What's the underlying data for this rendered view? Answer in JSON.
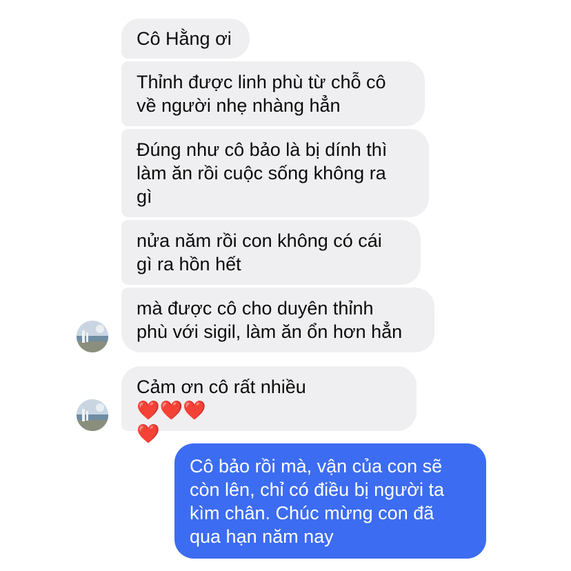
{
  "colors": {
    "incoming_bubble": "#efeff1",
    "outgoing_bubble": "#3c6cf1",
    "incoming_text": "#0b0b0b",
    "outgoing_text": "#ffffff"
  },
  "messages": [
    {
      "side": "incoming",
      "text": "Cô Hằng ơi"
    },
    {
      "side": "incoming",
      "text": "Thỉnh được linh phù từ chỗ cô\nvề người nhẹ nhàng hẳn"
    },
    {
      "side": "incoming",
      "text": "Đúng như cô bảo là bị dính thì\nlàm ăn rồi cuộc sống không ra\ngì"
    },
    {
      "side": "incoming",
      "text": "nửa năm rồi con không có cái\ngì ra hồn hết"
    },
    {
      "side": "incoming",
      "text": "mà được cô cho duyên thỉnh\nphù với sigil, làm ăn ổn hơn hẳn"
    },
    {
      "side": "incoming",
      "text": "Cảm ơn cô rất nhiều",
      "emoji": "❤️❤️❤️\n❤️"
    },
    {
      "side": "outgoing",
      "text": "Cô bảo rồi mà, vận của con sẽ\ncòn lên, chỉ có điều bị người ta\nkìm chân. Chúc mừng con đã\nqua hạn năm nay"
    }
  ],
  "avatar": {
    "icon": "contact-avatar-photo"
  }
}
